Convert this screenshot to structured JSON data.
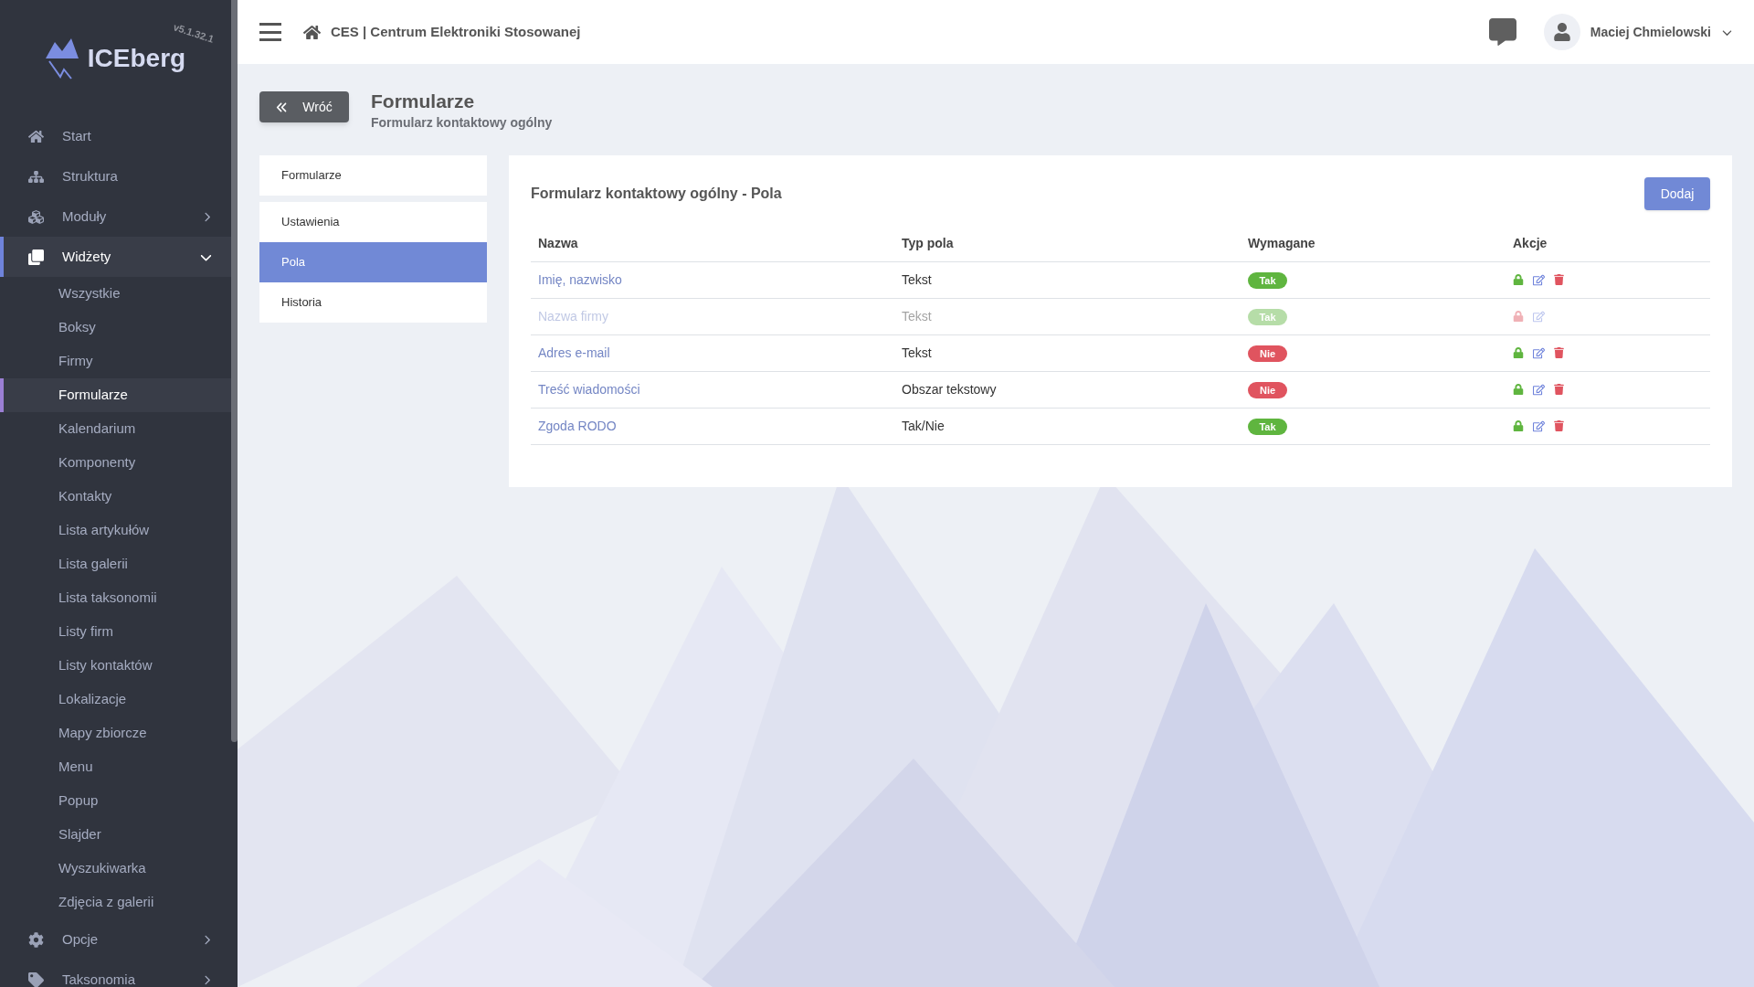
{
  "logo": {
    "name": "ICEberg",
    "version": "v5.1.32.1"
  },
  "sidebar": {
    "items": [
      {
        "label": "Start",
        "kind": "home",
        "selected": false
      },
      {
        "label": "Struktura",
        "kind": "tree",
        "selected": false
      },
      {
        "label": "Moduły",
        "kind": "cubes",
        "selected": false,
        "expanded": false
      },
      {
        "label": "Widżety",
        "kind": "clone",
        "selected": true,
        "expanded": true,
        "children": [
          {
            "label": "Wszystkie",
            "selected": false
          },
          {
            "label": "Boksy",
            "selected": false
          },
          {
            "label": "Firmy",
            "selected": false
          },
          {
            "label": "Formularze",
            "selected": true
          },
          {
            "label": "Kalendarium",
            "selected": false
          },
          {
            "label": "Komponenty",
            "selected": false
          },
          {
            "label": "Kontakty",
            "selected": false
          },
          {
            "label": "Lista artykułów",
            "selected": false
          },
          {
            "label": "Lista galerii",
            "selected": false
          },
          {
            "label": "Lista taksonomii",
            "selected": false
          },
          {
            "label": "Listy firm",
            "selected": false
          },
          {
            "label": "Listy kontaktów",
            "selected": false
          },
          {
            "label": "Lokalizacje",
            "selected": false
          },
          {
            "label": "Mapy zbiorcze",
            "selected": false
          },
          {
            "label": "Menu",
            "selected": false
          },
          {
            "label": "Popup",
            "selected": false
          },
          {
            "label": "Slajder",
            "selected": false
          },
          {
            "label": "Wyszukiwarka",
            "selected": false
          },
          {
            "label": "Zdjęcia z galerii",
            "selected": false
          }
        ]
      },
      {
        "label": "Opcje",
        "kind": "gear",
        "selected": false,
        "expanded": false
      },
      {
        "label": "Taksonomia",
        "kind": "tag",
        "selected": false,
        "expanded": false
      }
    ]
  },
  "header": {
    "breadcrumb": "CES | Centrum Elektroniki Stosowanej",
    "user": "Maciej Chmielowski"
  },
  "page": {
    "back_button": "Wróć",
    "title": "Formularze",
    "subtitle": "Formularz kontaktowy ogólny"
  },
  "subnav": [
    {
      "label": "Formularze",
      "selected": false
    },
    {
      "label": "Ustawienia",
      "selected": false
    },
    {
      "label": "Pola",
      "selected": true
    },
    {
      "label": "Historia",
      "selected": false
    }
  ],
  "card": {
    "title": "Formularz kontaktowy ogólny - Pola",
    "add_button": "Dodaj"
  },
  "table": {
    "columns": [
      "Nazwa",
      "Typ pola",
      "Wymagane",
      "Akcje"
    ],
    "rows": [
      {
        "name": "Imię, nazwisko",
        "type": "Tekst",
        "required": true,
        "required_label": "Tak",
        "disabled": false,
        "locked": false,
        "deletable": true
      },
      {
        "name": "Nazwa firmy",
        "type": "Tekst",
        "required": true,
        "required_label": "Tak",
        "disabled": true,
        "locked": true,
        "deletable": false
      },
      {
        "name": "Adres e-mail",
        "type": "Tekst",
        "required": false,
        "required_label": "Nie",
        "disabled": false,
        "locked": false,
        "deletable": true
      },
      {
        "name": "Treść wiadomości",
        "type": "Obszar tekstowy",
        "required": false,
        "required_label": "Nie",
        "disabled": false,
        "locked": false,
        "deletable": true
      },
      {
        "name": "Zgoda RODO",
        "type": "Tak/Nie",
        "required": true,
        "required_label": "Tak",
        "disabled": false,
        "locked": false,
        "deletable": true
      }
    ]
  }
}
